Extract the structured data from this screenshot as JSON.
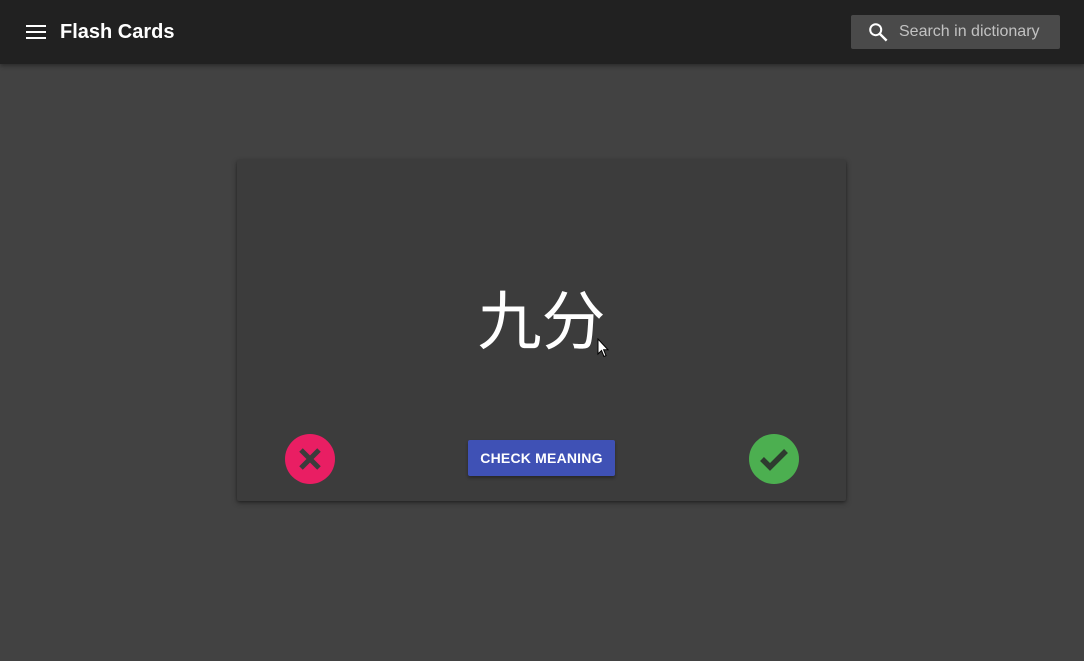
{
  "header": {
    "menu_icon": "menu-icon",
    "title": "Flash Cards",
    "search": {
      "icon": "search-icon",
      "placeholder": "Search in dictionary",
      "value": ""
    }
  },
  "card": {
    "term": "九分",
    "wrong_icon": "close-icon",
    "check_meaning_label": "CHECK MEANING",
    "right_icon": "check-icon"
  },
  "colors": {
    "background": "#424242",
    "appbar": "#212121",
    "card": "#3c3c3c",
    "wrong": "#e91e63",
    "right": "#4caf50",
    "primary": "#3f51b5"
  }
}
